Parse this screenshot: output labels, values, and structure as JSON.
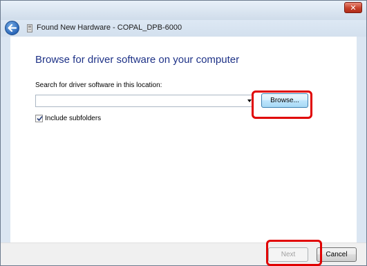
{
  "window": {
    "close_label": "✕",
    "title": "Found New Hardware - COPAL_DPB-6000"
  },
  "heading": "Browse for driver software on your computer",
  "search": {
    "label": "Search for driver software in this location:",
    "value": "",
    "browse_label": "Browse..."
  },
  "options": {
    "include_subfolders_label": "Include subfolders",
    "include_subfolders_checked": true
  },
  "footer": {
    "next_label": "Next",
    "cancel_label": "Cancel"
  },
  "annotations": {
    "highlight_color": "#e00000",
    "highlighted": [
      "browse-button",
      "next-button"
    ]
  },
  "icons": {
    "back": "back-arrow-icon",
    "hardware": "hardware-device-icon",
    "dropdown": "chevron-down-icon",
    "check": "checkmark-icon"
  }
}
